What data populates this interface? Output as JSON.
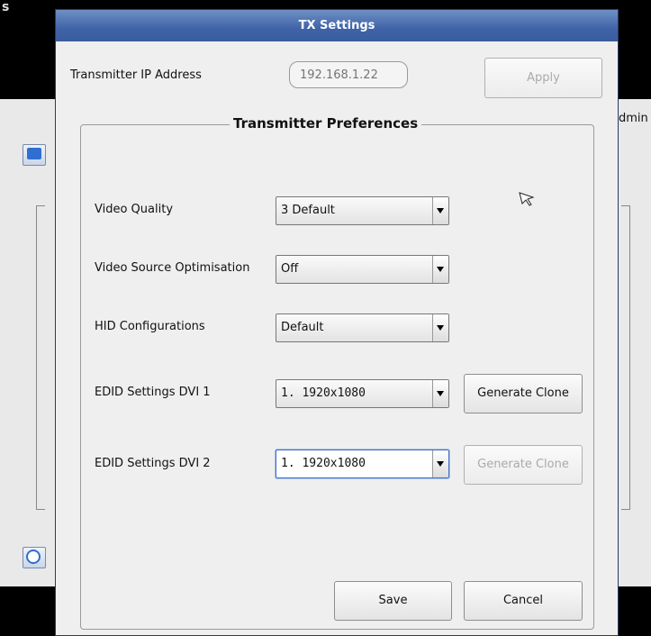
{
  "dialog": {
    "title": "TX Settings",
    "ip_label": "Transmitter IP Address",
    "ip_placeholder": "192.168.1.22",
    "apply_label": "Apply",
    "group_title": "Transmitter Preferences",
    "rows": [
      {
        "label": "Video Quality",
        "value": "3 Default"
      },
      {
        "label": "Video Source Optimisation",
        "value": "Off"
      },
      {
        "label": "HID Configurations",
        "value": "Default"
      },
      {
        "label": "EDID Settings  DVI 1",
        "value": "1. 1920x1080",
        "button": "Generate Clone"
      },
      {
        "label": "EDID Settings  DVI 2",
        "value": "1. 1920x1080",
        "button": "Generate Clone"
      }
    ],
    "save_label": "Save",
    "cancel_label": "Cancel"
  },
  "background": {
    "admin_fragment": "dmin",
    "corner_text": "s"
  },
  "colors": {
    "title_bar": "#3f63a6",
    "dialog_bg": "#efefef",
    "focus": "#3f6fc6"
  },
  "icons": [
    "screen-icon",
    "power-icon",
    "mouse-pointer-icon",
    "dropdown-arrow-icon"
  ]
}
